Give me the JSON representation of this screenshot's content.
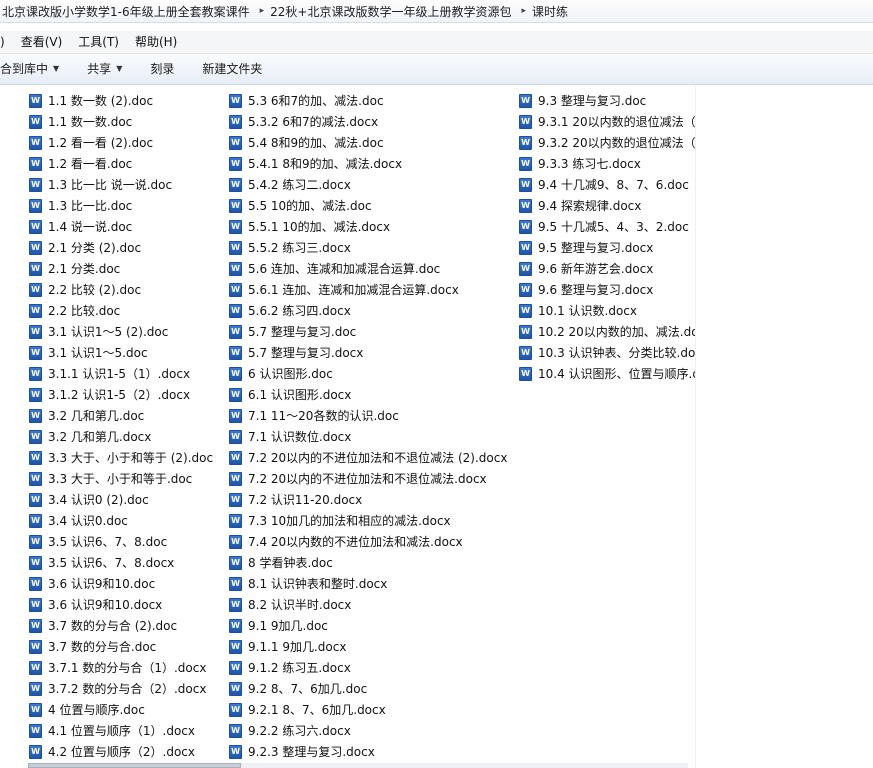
{
  "breadcrumbs": [
    "北京课改版小学数学1-6年级上册全套教案课件",
    "22秋+北京课改版数学一年级上册教学资源包",
    "课时练"
  ],
  "menu": [
    ")",
    "查看(V)",
    "工具(T)",
    "帮助(H)"
  ],
  "toolbar": {
    "include_label": "合到库中",
    "share_label": "共享",
    "burn_label": "刻录",
    "newfolder_label": "新建文件夹"
  },
  "icon_letter": "W",
  "files": {
    "col1": [
      "1.1 数一数 (2).doc",
      "1.1 数一数.doc",
      "1.2 看一看 (2).doc",
      "1.2 看一看.doc",
      "1.3 比一比  说一说.doc",
      "1.3 比一比.doc",
      "1.4 说一说.doc",
      "2.1 分类 (2).doc",
      "2.1 分类.doc",
      "2.2 比较 (2).doc",
      "2.2 比较.doc",
      "3.1 认识1～5 (2).doc",
      "3.1 认识1～5.doc",
      "3.1.1 认识1-5（1）.docx",
      "3.1.2 认识1-5（2）.docx",
      "3.2 几和第几.doc",
      "3.2 几和第几.docx",
      "3.3 大于、小于和等于 (2).doc",
      "3.3 大于、小于和等于.doc",
      "3.4 认识0 (2).doc",
      "3.4 认识0.doc",
      "3.5 认识6、7、8.doc",
      "3.5 认识6、7、8.docx",
      "3.6 认识9和10.doc",
      "3.6 认识9和10.docx",
      "3.7 数的分与合 (2).doc",
      "3.7 数的分与合.doc",
      "3.7.1 数的分与合（1）.docx",
      "3.7.2 数的分与合（2）.docx",
      "4 位置与顺序.doc",
      "4.1 位置与顺序（1）.docx",
      "4.2 位置与顺序（2）.docx"
    ],
    "col2": [
      "5.3 6和7的加、减法.doc",
      "5.3.2 6和7的减法.docx",
      "5.4 8和9的加、减法.doc",
      "5.4.1 8和9的加、减法.docx",
      "5.4.2 练习二.docx",
      "5.5 10的加、减法.doc",
      "5.5.1 10的加、减法.docx",
      "5.5.2 练习三.docx",
      "5.6 连加、连减和加减混合运算.doc",
      "5.6.1 连加、连减和加减混合运算.docx",
      "5.6.2 练习四.docx",
      "5.7 整理与复习.doc",
      "5.7 整理与复习.docx",
      "6 认识图形.doc",
      "6.1 认识图形.docx",
      "7.1 11～20各数的认识.doc",
      "7.1 认识数位.docx",
      "7.2 20以内的不进位加法和不退位减法 (2).docx",
      "7.2 20以内的不进位加法和不退位减法.docx",
      "7.2 认识11-20.docx",
      "7.3 10加几的加法和相应的减法.docx",
      "7.4 20以内数的不进位加法和减法.docx",
      "8 学看钟表.doc",
      "8.1 认识钟表和整时.docx",
      "8.2 认识半时.docx",
      "9.1 9加几.doc",
      "9.1.1 9加几.docx",
      "9.1.2 练习五.docx",
      "9.2 8、7、6加几.doc",
      "9.2.1 8、7、6加几.docx",
      "9.2.2 练习六.docx",
      "9.2.3 整理与复习.docx"
    ],
    "col3": [
      "9.3 整理与复习.doc",
      "9.3.1 20以内数的退位减法（1",
      "9.3.2 20以内数的退位减法（2",
      "9.3.3 练习七.docx",
      "9.4 十几减9、8、7、6.doc",
      "9.4 探索规律.docx",
      "9.5 十几减5、4、3、2.doc",
      "9.5 整理与复习.docx",
      "9.6 新年游艺会.docx",
      "9.6 整理与复习.docx",
      "10.1 认识数.docx",
      "10.2 20以内数的加、减法.do",
      "10.3 认识钟表、分类比较.doc",
      "10.4 认识图形、位置与顺序.d"
    ]
  }
}
